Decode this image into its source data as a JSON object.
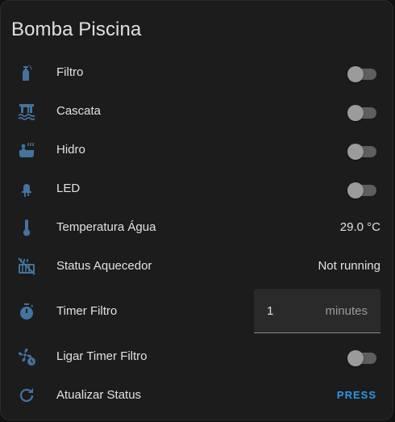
{
  "card": {
    "title": "Bomba Piscina"
  },
  "entities": {
    "filtro": {
      "label": "Filtro",
      "icon": "spray-bottle-icon",
      "state": "off"
    },
    "cascata": {
      "label": "Cascata",
      "icon": "waterfall-icon",
      "state": "off"
    },
    "hidro": {
      "label": "Hidro",
      "icon": "hot-tub-icon",
      "state": "off"
    },
    "led": {
      "label": "LED",
      "icon": "led-icon",
      "state": "off"
    },
    "temperatura": {
      "label": "Temperatura Água",
      "icon": "thermometer-icon",
      "value": "29.0 °C"
    },
    "status_aquecedor": {
      "label": "Status Aquecedor",
      "icon": "heater-off-icon",
      "value": "Not running"
    },
    "timer_filtro": {
      "label": "Timer Filtro",
      "icon": "timer-icon",
      "value": "1",
      "unit": "minutes"
    },
    "ligar_timer": {
      "label": "Ligar Timer Filtro",
      "icon": "fan-clock-icon",
      "state": "off"
    },
    "atualizar": {
      "label": "Atualizar Status",
      "icon": "refresh-icon",
      "action": "PRESS"
    }
  },
  "colors": {
    "icon": "#44739e",
    "accent": "#2a98e8",
    "text": "#e1e1e1",
    "card_bg": "#1c1c1c"
  }
}
